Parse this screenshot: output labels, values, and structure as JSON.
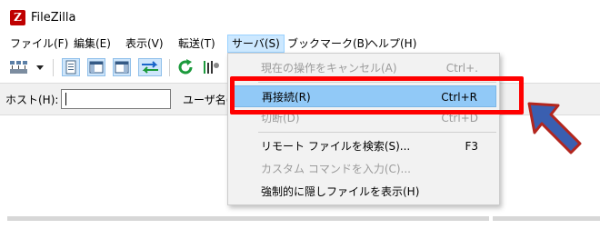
{
  "window": {
    "title": "FileZilla",
    "icon_glyph": "Z"
  },
  "menubar": {
    "items": [
      {
        "label": "ファイル(F)"
      },
      {
        "label": "編集(E)"
      },
      {
        "label": "表示(V)"
      },
      {
        "label": "転送(T)"
      },
      {
        "label": "サーバ(S)",
        "open": true
      },
      {
        "label": "ブックマーク(B)"
      },
      {
        "label": "ヘルプ(H)"
      }
    ]
  },
  "toolbar": {
    "buttons": [
      "site-manager-icon",
      "dropdown-arrow-icon",
      "message-log-icon",
      "local-tree-icon",
      "remote-tree-icon",
      "transfer-queue-icon",
      "refresh-icon",
      "process-queue-icon"
    ]
  },
  "quickconnect": {
    "host_label": "ホスト(H):",
    "host_value": "",
    "user_label": "ユーザ名("
  },
  "server_menu": {
    "items": [
      {
        "label": "現在の操作をキャンセル(A)",
        "shortcut": "Ctrl+.",
        "disabled": true
      },
      {
        "label": "再接続(R)",
        "shortcut": "Ctrl+R",
        "highlighted": true
      },
      {
        "label": "切断(D)",
        "shortcut": "Ctrl+D",
        "disabled": true
      },
      {
        "label": "リモート ファイルを検索(S)...",
        "shortcut": "F3"
      },
      {
        "label": "カスタム コマンドを入力(C)...",
        "shortcut": "",
        "disabled": true
      },
      {
        "label": "強制的に隠しファイルを表示(H)",
        "shortcut": ""
      }
    ]
  },
  "colors": {
    "annotation_red": "#ff0000",
    "arrow_blue": "#3a5fb0",
    "highlight_blue": "#91c9f7",
    "app_icon_red": "#bf0000"
  }
}
